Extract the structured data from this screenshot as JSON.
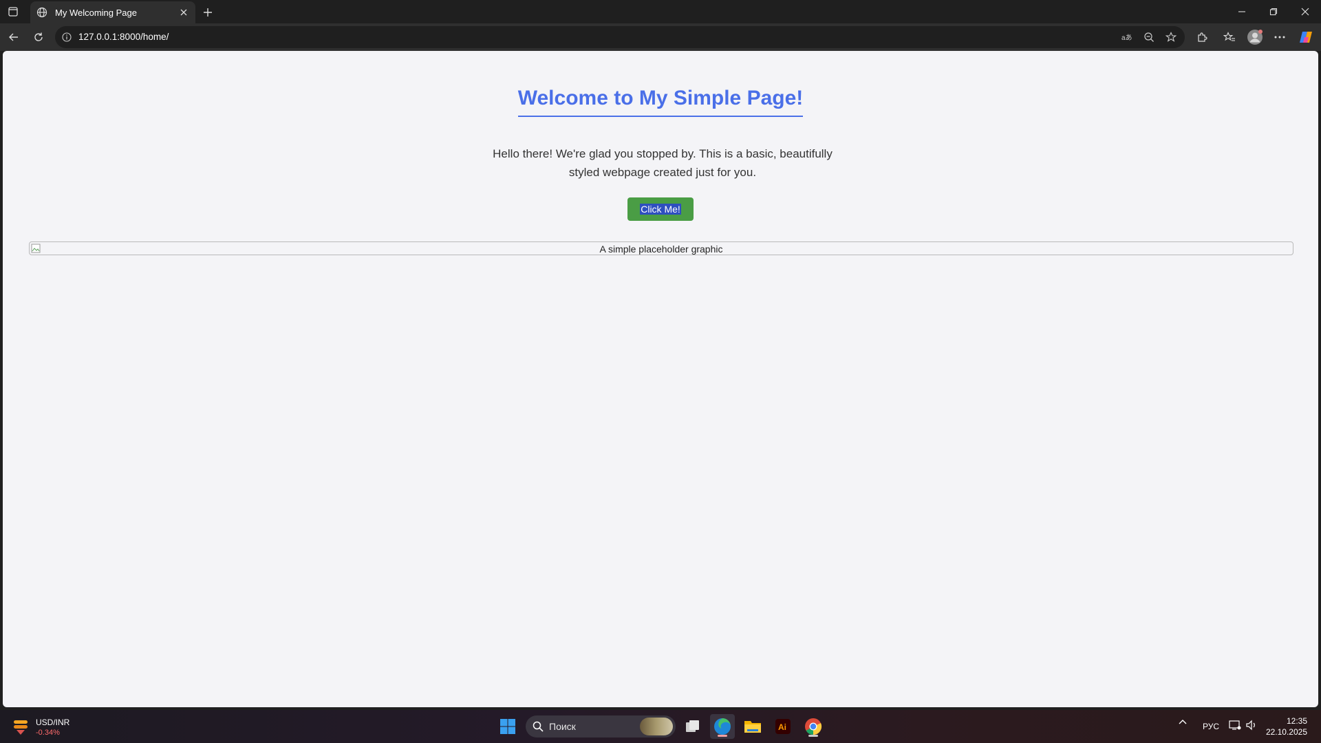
{
  "browser": {
    "tab_title": "My Welcoming Page",
    "url": "127.0.0.1:8000/home/"
  },
  "page": {
    "heading": "Welcome to My Simple Page!",
    "intro": "Hello there! We're glad you stopped by. This is a basic, beautifully styled webpage created just for you.",
    "button_label": "Click Me!",
    "image_alt": "A simple placeholder graphic"
  },
  "taskbar": {
    "widget_pair": "USD/INR",
    "widget_change": "-0.34%",
    "search_label": "Поиск",
    "language": "РУС",
    "time": "12:35",
    "date": "22.10.2025"
  },
  "colors": {
    "accent_blue": "#4a6fe8",
    "button_green": "#4a9d45"
  }
}
